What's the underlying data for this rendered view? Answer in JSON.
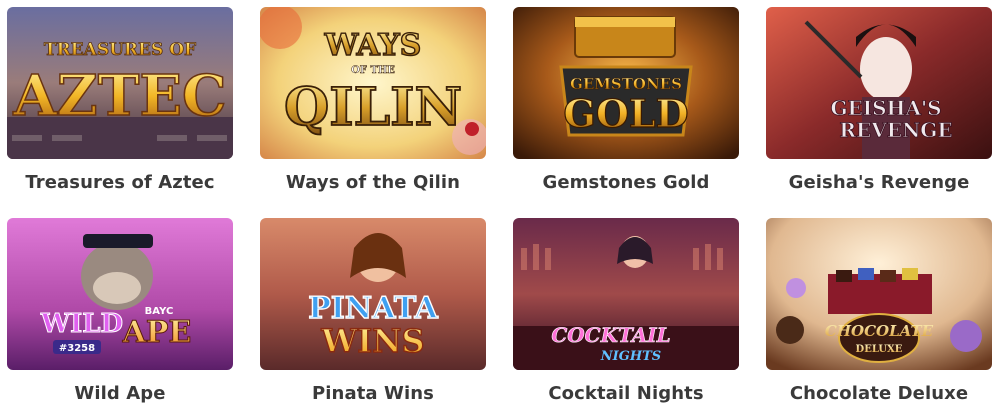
{
  "games": [
    {
      "title": "Treasures of Aztec",
      "logo": "TREASURES OF AZTEC"
    },
    {
      "title": "Ways of the Qilin",
      "logo": "WAYS OF THE QILIN"
    },
    {
      "title": "Gemstones Gold",
      "logo": "GEMSTONES GOLD"
    },
    {
      "title": "Geisha's Revenge",
      "logo": "GEISHA'S REVENGE"
    },
    {
      "title": "Wild Ape",
      "logo": "WILD APE #3258 BAYC"
    },
    {
      "title": "Pinata Wins",
      "logo": "PINATA WINS"
    },
    {
      "title": "Cocktail Nights",
      "logo": "COCKTAIL NIGHTS"
    },
    {
      "title": "Chocolate Deluxe",
      "logo": "CHOCOLATE DELUXE"
    }
  ]
}
